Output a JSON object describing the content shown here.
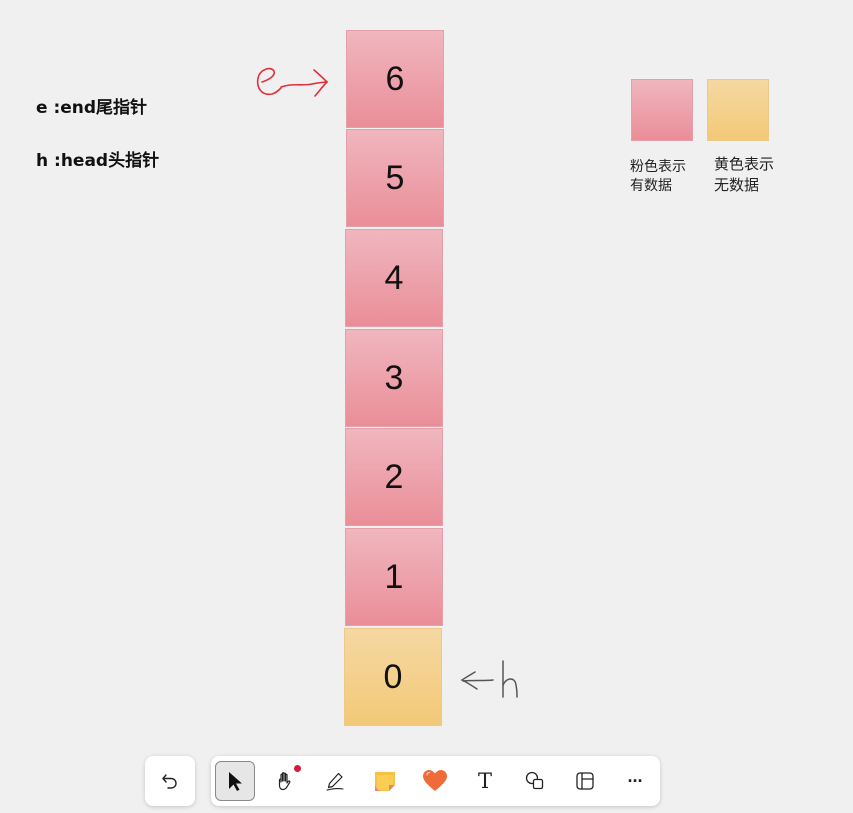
{
  "notes": {
    "end_pointer": "e :end尾指针",
    "head_pointer": "h :head头指针"
  },
  "cells": [
    {
      "value": "6",
      "state": "pink"
    },
    {
      "value": "5",
      "state": "pink"
    },
    {
      "value": "4",
      "state": "pink"
    },
    {
      "value": "3",
      "state": "pink"
    },
    {
      "value": "2",
      "state": "pink"
    },
    {
      "value": "1",
      "state": "pink"
    },
    {
      "value": "0",
      "state": "yellow"
    }
  ],
  "legend": {
    "pink_label_line1": "粉色表示",
    "pink_label_line2": "有数据",
    "yellow_label_line1": "黄色表示",
    "yellow_label_line2": "无数据"
  },
  "colors": {
    "pink": "#ec9aa4",
    "yellow": "#f4cf86",
    "end_arrow": "#e0303a",
    "head_arrow": "#555555"
  },
  "toolbar": {
    "items": [
      {
        "name": "select-tool",
        "icon": "cursor-arrow-icon",
        "active": true
      },
      {
        "name": "pan-tool",
        "icon": "hand-icon",
        "active": false
      },
      {
        "name": "pen-tool",
        "icon": "pen-icon",
        "active": false
      },
      {
        "name": "sticky-note-tool",
        "icon": "sticky-note-icon",
        "active": false
      },
      {
        "name": "reaction-tool",
        "icon": "heart-icon",
        "active": false
      },
      {
        "name": "text-tool",
        "icon": "text-icon",
        "active": false
      },
      {
        "name": "shapes-tool",
        "icon": "shapes-icon",
        "active": false
      },
      {
        "name": "template-tool",
        "icon": "layout-icon",
        "active": false
      },
      {
        "name": "more-tool",
        "icon": "more-icon",
        "active": false
      }
    ],
    "text_glyph": "T",
    "more_glyph": "···"
  }
}
